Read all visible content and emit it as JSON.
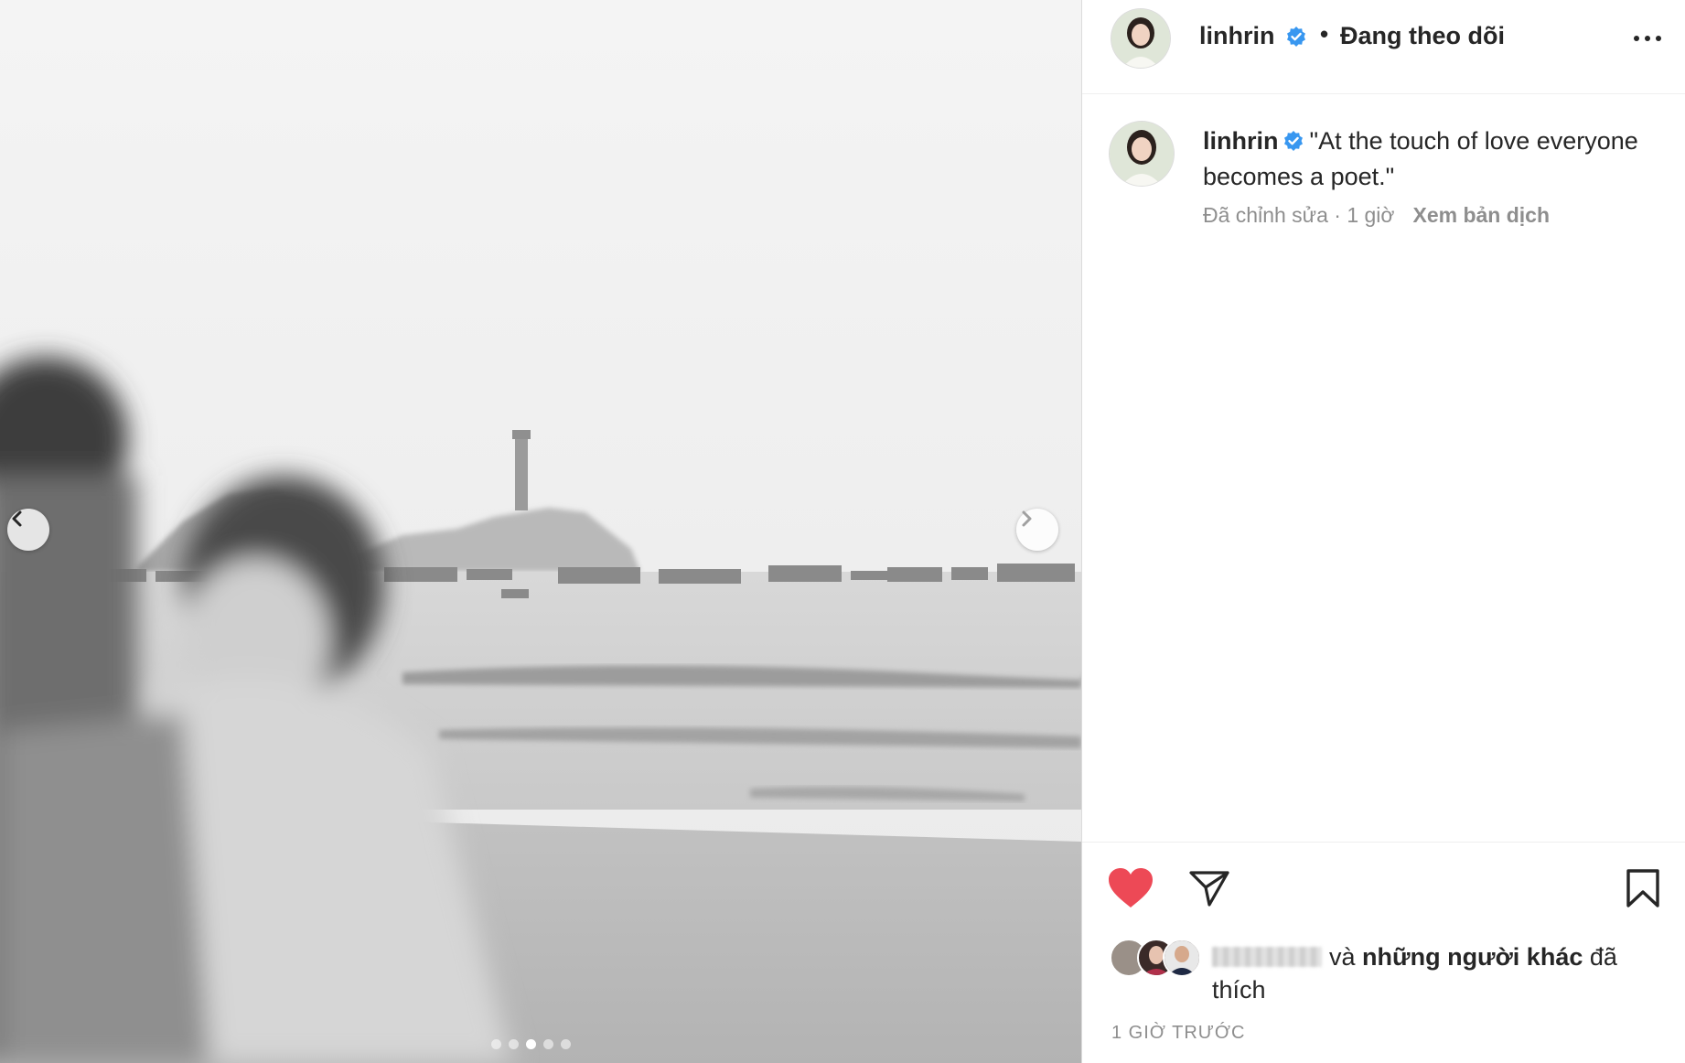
{
  "post": {
    "username": "linhrin",
    "verified": true,
    "separator": "•",
    "follow_status": "Đang theo dõi",
    "more_icon": "more-horizontal-icon"
  },
  "caption": {
    "username": "linhrin",
    "text": "\"At the touch of love everyone becomes a poet.\"",
    "edited_label": "Đã chỉnh sửa",
    "meta_separator": " · ",
    "age": "1 giờ",
    "translate_label": "Xem bản dịch"
  },
  "carousel": {
    "total_slides": 5,
    "active_slide": 3,
    "prev_icon": "chevron-left-icon",
    "next_icon": "chevron-right-icon"
  },
  "actions": {
    "like_icon": "heart-filled-icon",
    "share_icon": "paper-plane-icon",
    "save_icon": "bookmark-icon",
    "liked": true,
    "like_color": "#ED4956"
  },
  "likes": {
    "conjunction": "và",
    "others_label": "những người khác",
    "suffix": "đã thích"
  },
  "timestamp": "1 GIỜ TRƯỚC",
  "colors": {
    "verified_blue": "#3897F0",
    "secondary_text": "#8E8E8E",
    "primary_text": "#262626"
  }
}
